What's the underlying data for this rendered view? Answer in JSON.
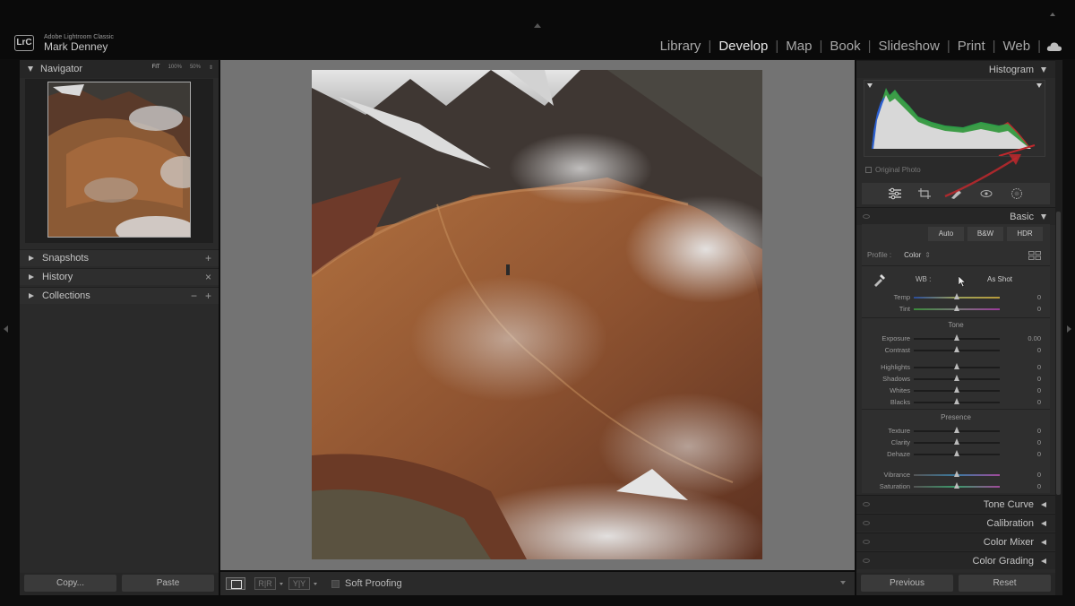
{
  "window": {
    "app_name": "Adobe Lightroom Classic",
    "user_name": "Mark Denney",
    "logo_text": "LrC"
  },
  "modules": [
    {
      "label": "Library",
      "active": false
    },
    {
      "label": "Develop",
      "active": true
    },
    {
      "label": "Map",
      "active": false
    },
    {
      "label": "Book",
      "active": false
    },
    {
      "label": "Slideshow",
      "active": false
    },
    {
      "label": "Print",
      "active": false
    },
    {
      "label": "Web",
      "active": false
    }
  ],
  "left_panel": {
    "navigator": {
      "title": "Navigator",
      "zoom_fit": "FIT",
      "zoom_100": "100%",
      "zoom_50": "50%",
      "zoom_arrows": "⇕"
    },
    "snapshots": {
      "title": "Snapshots",
      "action": "+"
    },
    "history": {
      "title": "History",
      "action": "×"
    },
    "collections": {
      "title": "Collections",
      "action_minus": "−",
      "action_plus": "+"
    },
    "copy_label": "Copy...",
    "paste_label": "Paste"
  },
  "toolbar": {
    "soft_proofing_label": "Soft Proofing",
    "compare_ry": "R|R",
    "compare_yy": "Y|Y"
  },
  "right_panel": {
    "histogram": {
      "title": "Histogram",
      "original_photo_label": "Original Photo"
    },
    "tools": [
      "sliders-icon",
      "crop-icon",
      "heal-icon",
      "redeye-icon",
      "masking-icon"
    ],
    "basic": {
      "title": "Basic",
      "treatment_buttons": [
        "Auto",
        "B&W",
        "HDR"
      ],
      "profile_label": "Profile :",
      "profile_value": "Color",
      "wb_label": "WB :",
      "wb_value": "As Shot",
      "tone_title": "Tone",
      "presence_title": "Presence",
      "sliders": {
        "temp": {
          "label": "Temp",
          "value": "0",
          "position": 0.5
        },
        "tint": {
          "label": "Tint",
          "value": "0",
          "position": 0.5
        },
        "exposure": {
          "label": "Exposure",
          "value": "0.00",
          "position": 0.5
        },
        "contrast": {
          "label": "Contrast",
          "value": "0",
          "position": 0.5
        },
        "highlights": {
          "label": "Highlights",
          "value": "0",
          "position": 0.5
        },
        "shadows": {
          "label": "Shadows",
          "value": "0",
          "position": 0.5
        },
        "whites": {
          "label": "Whites",
          "value": "0",
          "position": 0.5
        },
        "blacks": {
          "label": "Blacks",
          "value": "0",
          "position": 0.5
        },
        "texture": {
          "label": "Texture",
          "value": "0",
          "position": 0.5
        },
        "clarity": {
          "label": "Clarity",
          "value": "0",
          "position": 0.5
        },
        "dehaze": {
          "label": "Dehaze",
          "value": "0",
          "position": 0.5
        },
        "vibrance": {
          "label": "Vibrance",
          "value": "0",
          "position": 0.5
        },
        "saturation": {
          "label": "Saturation",
          "value": "0",
          "position": 0.5
        }
      }
    },
    "tone_curve": {
      "title": "Tone Curve"
    },
    "calibration": {
      "title": "Calibration"
    },
    "color_mixer": {
      "title": "Color Mixer"
    },
    "color_grading": {
      "title": "Color Grading"
    },
    "previous_label": "Previous",
    "reset_label": "Reset"
  },
  "colors": {
    "accent_red": "#c0282d",
    "panel_bg": "#2a2a2a",
    "canvas_gray": "#737373"
  }
}
